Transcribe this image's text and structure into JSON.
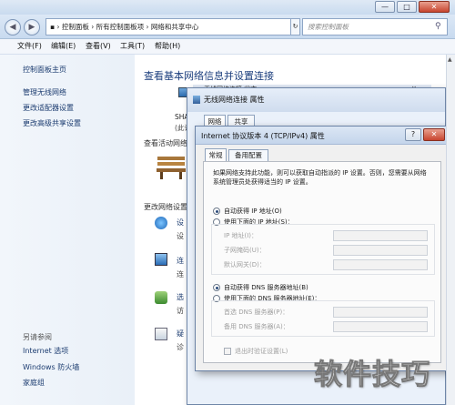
{
  "window": {
    "minimize": "—",
    "maximize": "□",
    "close": "✕"
  },
  "address": {
    "path": "▪ › 控制面板 › 所有控制面板项 › 网络和共享中心",
    "search_placeholder": "搜索控制面板"
  },
  "menu": [
    "文件(F)",
    "编辑(E)",
    "查看(V)",
    "工具(T)",
    "帮助(H)"
  ],
  "sidebar": {
    "items": [
      "控制面板主页",
      "管理无线网络",
      "更改适配器设置",
      "更改高级共享设置"
    ],
    "see_also_title": "另请参阅",
    "see_also": [
      "Internet 选项",
      "Windows 防火墙",
      "家庭组"
    ]
  },
  "main": {
    "title": "查看基本网络信息并设置连接",
    "computer_short": "SHA",
    "computer_sub": "(此计",
    "active_networks": "查看活动网络",
    "change_settings": "更改网络设置",
    "tasks": [
      {
        "a": "设",
        "b": "设"
      },
      {
        "a": "连",
        "b": "连"
      },
      {
        "a": "选",
        "b": "访"
      },
      {
        "a": "疑",
        "b": "诊"
      }
    ]
  },
  "bg_window": {
    "title": "无线网络连接 状态",
    "close": "×",
    "right_frag": "看完",
    "right_frag2": "起"
  },
  "dialog1": {
    "title": "无线网络连接 属性",
    "tabs": [
      "网络",
      "共享"
    ],
    "close": "✕"
  },
  "dialog2": {
    "title": "Internet 协议版本 4 (TCP/IPv4) 属性",
    "help": "?",
    "close": "✕",
    "tabs": [
      "常规",
      "备用配置"
    ],
    "desc": "如果网络支持此功能，则可以获取自动指派的 IP 设置。否则，您需要从网络系统管理员处获得适当的 IP 设置。",
    "auto_ip": "自动获得 IP 地址(O)",
    "manual_ip": "使用下面的 IP 地址(S)：",
    "ip_fields": [
      "IP 地址(I)：",
      "子网掩码(U)：",
      "默认网关(D)："
    ],
    "auto_dns": "自动获得 DNS 服务器地址(B)",
    "manual_dns": "使用下面的 DNS 服务器地址(E)：",
    "dns_fields": [
      "首选 DNS 服务器(P)：",
      "备用 DNS 服务器(A)："
    ],
    "validate": "退出时验证设置(L)"
  },
  "watermark": "软件技巧"
}
